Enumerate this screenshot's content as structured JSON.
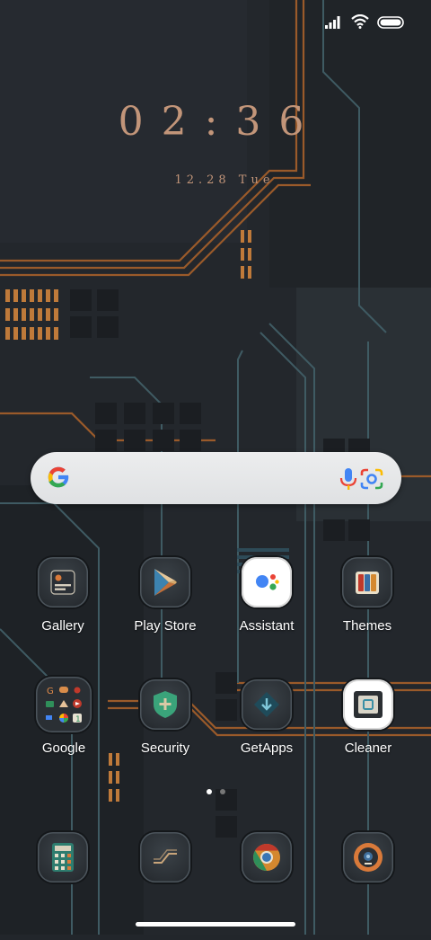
{
  "status_bar": {
    "icons": [
      "signal-icon",
      "wifi-icon",
      "battery-icon"
    ]
  },
  "clock": {
    "time": "02:36",
    "date": "12.28 Tue"
  },
  "search_bar": {
    "icons": [
      "google-g-icon",
      "microphone-icon",
      "google-lens-icon"
    ]
  },
  "apps": [
    {
      "label": "Gallery"
    },
    {
      "label": "Play Store"
    },
    {
      "label": "Assistant"
    },
    {
      "label": "Themes"
    },
    {
      "label": "Google"
    },
    {
      "label": "Security"
    },
    {
      "label": "GetApps"
    },
    {
      "label": "Cleaner"
    }
  ],
  "dock": [
    {
      "icon": "calculator-icon"
    },
    {
      "icon": "finance-icon"
    },
    {
      "icon": "chrome-icon"
    },
    {
      "icon": "camera-icon"
    }
  ],
  "page_indicator": {
    "pages": 2,
    "current": 1
  },
  "colors": {
    "accent_copper": "#c29579",
    "circuit_orange": "#a8602c",
    "circuit_teal": "#3d5962",
    "background": "#22262b"
  }
}
